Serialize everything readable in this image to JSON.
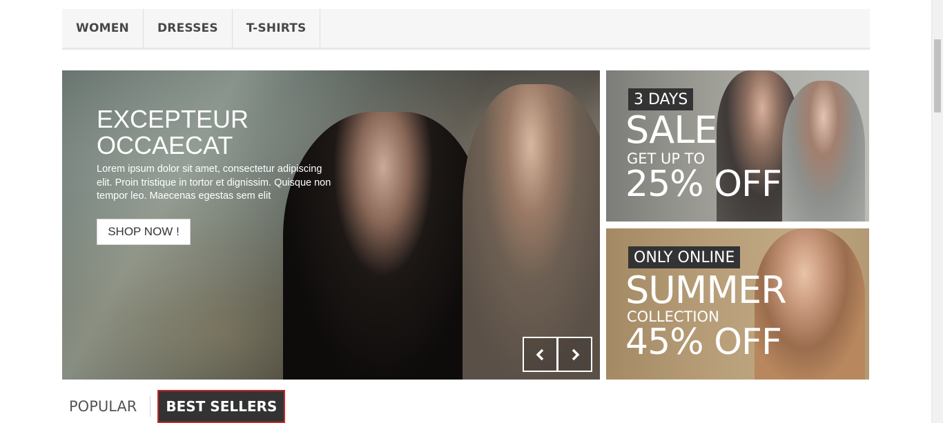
{
  "menu": {
    "items": [
      {
        "label": "WOMEN"
      },
      {
        "label": "DRESSES"
      },
      {
        "label": "T-SHIRTS"
      }
    ]
  },
  "slider": {
    "title": "EXCEPTEUR OCCAECAT",
    "text": "Lorem ipsum dolor sit amet, consectetur adipiscing elit. Proin tristique in tortor et dignissim. Quisque non tempor leo. Maecenas egestas sem elit",
    "button_label": "SHOP NOW !",
    "prev_icon": "chevron-left-icon",
    "next_icon": "chevron-right-icon"
  },
  "banners": [
    {
      "tag": "3 DAYS",
      "big": "SALE",
      "mid": "GET UP TO",
      "pct": "25% OFF"
    },
    {
      "tag": "ONLY ONLINE",
      "big": "SUMMER",
      "mid": "COLLECTION",
      "pct": "45% OFF"
    }
  ],
  "tabs": [
    {
      "label": "POPULAR",
      "active": false
    },
    {
      "label": "BEST SELLERS",
      "active": true
    }
  ],
  "colors": {
    "menu_bg": "#f6f6f6",
    "tag_bg": "#333333",
    "active_tab_border": "#c42a2a",
    "text_dark": "#484848"
  }
}
